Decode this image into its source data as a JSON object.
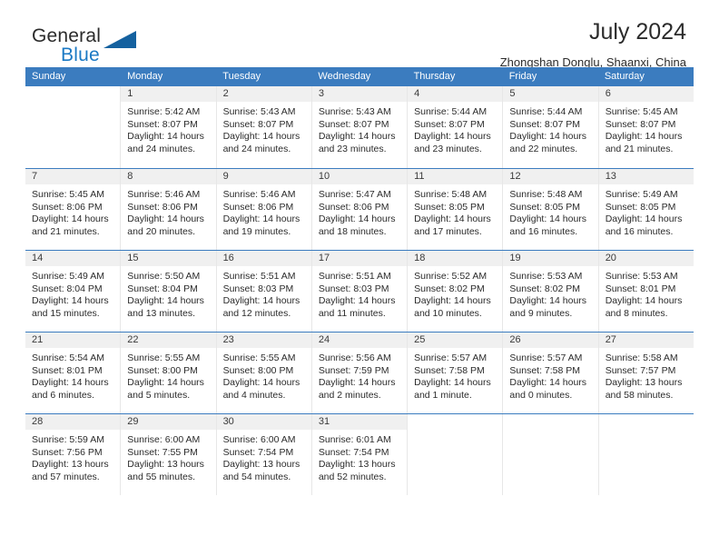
{
  "brand": {
    "word_general": "General",
    "word_blue": "Blue",
    "flag_icon": "blue-triangle-icon"
  },
  "header": {
    "title": "July 2024",
    "location": "Zhongshan Donglu, Shaanxi, China",
    "accent_color": "#3b7cbf"
  },
  "weekdays": [
    "Sunday",
    "Monday",
    "Tuesday",
    "Wednesday",
    "Thursday",
    "Friday",
    "Saturday"
  ],
  "weeks": [
    [
      {
        "day": "",
        "sunrise": "",
        "sunset": "",
        "daylight": ""
      },
      {
        "day": "1",
        "sunrise": "Sunrise: 5:42 AM",
        "sunset": "Sunset: 8:07 PM",
        "daylight": "Daylight: 14 hours and 24 minutes."
      },
      {
        "day": "2",
        "sunrise": "Sunrise: 5:43 AM",
        "sunset": "Sunset: 8:07 PM",
        "daylight": "Daylight: 14 hours and 24 minutes."
      },
      {
        "day": "3",
        "sunrise": "Sunrise: 5:43 AM",
        "sunset": "Sunset: 8:07 PM",
        "daylight": "Daylight: 14 hours and 23 minutes."
      },
      {
        "day": "4",
        "sunrise": "Sunrise: 5:44 AM",
        "sunset": "Sunset: 8:07 PM",
        "daylight": "Daylight: 14 hours and 23 minutes."
      },
      {
        "day": "5",
        "sunrise": "Sunrise: 5:44 AM",
        "sunset": "Sunset: 8:07 PM",
        "daylight": "Daylight: 14 hours and 22 minutes."
      },
      {
        "day": "6",
        "sunrise": "Sunrise: 5:45 AM",
        "sunset": "Sunset: 8:07 PM",
        "daylight": "Daylight: 14 hours and 21 minutes."
      }
    ],
    [
      {
        "day": "7",
        "sunrise": "Sunrise: 5:45 AM",
        "sunset": "Sunset: 8:06 PM",
        "daylight": "Daylight: 14 hours and 21 minutes."
      },
      {
        "day": "8",
        "sunrise": "Sunrise: 5:46 AM",
        "sunset": "Sunset: 8:06 PM",
        "daylight": "Daylight: 14 hours and 20 minutes."
      },
      {
        "day": "9",
        "sunrise": "Sunrise: 5:46 AM",
        "sunset": "Sunset: 8:06 PM",
        "daylight": "Daylight: 14 hours and 19 minutes."
      },
      {
        "day": "10",
        "sunrise": "Sunrise: 5:47 AM",
        "sunset": "Sunset: 8:06 PM",
        "daylight": "Daylight: 14 hours and 18 minutes."
      },
      {
        "day": "11",
        "sunrise": "Sunrise: 5:48 AM",
        "sunset": "Sunset: 8:05 PM",
        "daylight": "Daylight: 14 hours and 17 minutes."
      },
      {
        "day": "12",
        "sunrise": "Sunrise: 5:48 AM",
        "sunset": "Sunset: 8:05 PM",
        "daylight": "Daylight: 14 hours and 16 minutes."
      },
      {
        "day": "13",
        "sunrise": "Sunrise: 5:49 AM",
        "sunset": "Sunset: 8:05 PM",
        "daylight": "Daylight: 14 hours and 16 minutes."
      }
    ],
    [
      {
        "day": "14",
        "sunrise": "Sunrise: 5:49 AM",
        "sunset": "Sunset: 8:04 PM",
        "daylight": "Daylight: 14 hours and 15 minutes."
      },
      {
        "day": "15",
        "sunrise": "Sunrise: 5:50 AM",
        "sunset": "Sunset: 8:04 PM",
        "daylight": "Daylight: 14 hours and 13 minutes."
      },
      {
        "day": "16",
        "sunrise": "Sunrise: 5:51 AM",
        "sunset": "Sunset: 8:03 PM",
        "daylight": "Daylight: 14 hours and 12 minutes."
      },
      {
        "day": "17",
        "sunrise": "Sunrise: 5:51 AM",
        "sunset": "Sunset: 8:03 PM",
        "daylight": "Daylight: 14 hours and 11 minutes."
      },
      {
        "day": "18",
        "sunrise": "Sunrise: 5:52 AM",
        "sunset": "Sunset: 8:02 PM",
        "daylight": "Daylight: 14 hours and 10 minutes."
      },
      {
        "day": "19",
        "sunrise": "Sunrise: 5:53 AM",
        "sunset": "Sunset: 8:02 PM",
        "daylight": "Daylight: 14 hours and 9 minutes."
      },
      {
        "day": "20",
        "sunrise": "Sunrise: 5:53 AM",
        "sunset": "Sunset: 8:01 PM",
        "daylight": "Daylight: 14 hours and 8 minutes."
      }
    ],
    [
      {
        "day": "21",
        "sunrise": "Sunrise: 5:54 AM",
        "sunset": "Sunset: 8:01 PM",
        "daylight": "Daylight: 14 hours and 6 minutes."
      },
      {
        "day": "22",
        "sunrise": "Sunrise: 5:55 AM",
        "sunset": "Sunset: 8:00 PM",
        "daylight": "Daylight: 14 hours and 5 minutes."
      },
      {
        "day": "23",
        "sunrise": "Sunrise: 5:55 AM",
        "sunset": "Sunset: 8:00 PM",
        "daylight": "Daylight: 14 hours and 4 minutes."
      },
      {
        "day": "24",
        "sunrise": "Sunrise: 5:56 AM",
        "sunset": "Sunset: 7:59 PM",
        "daylight": "Daylight: 14 hours and 2 minutes."
      },
      {
        "day": "25",
        "sunrise": "Sunrise: 5:57 AM",
        "sunset": "Sunset: 7:58 PM",
        "daylight": "Daylight: 14 hours and 1 minute."
      },
      {
        "day": "26",
        "sunrise": "Sunrise: 5:57 AM",
        "sunset": "Sunset: 7:58 PM",
        "daylight": "Daylight: 14 hours and 0 minutes."
      },
      {
        "day": "27",
        "sunrise": "Sunrise: 5:58 AM",
        "sunset": "Sunset: 7:57 PM",
        "daylight": "Daylight: 13 hours and 58 minutes."
      }
    ],
    [
      {
        "day": "28",
        "sunrise": "Sunrise: 5:59 AM",
        "sunset": "Sunset: 7:56 PM",
        "daylight": "Daylight: 13 hours and 57 minutes."
      },
      {
        "day": "29",
        "sunrise": "Sunrise: 6:00 AM",
        "sunset": "Sunset: 7:55 PM",
        "daylight": "Daylight: 13 hours and 55 minutes."
      },
      {
        "day": "30",
        "sunrise": "Sunrise: 6:00 AM",
        "sunset": "Sunset: 7:54 PM",
        "daylight": "Daylight: 13 hours and 54 minutes."
      },
      {
        "day": "31",
        "sunrise": "Sunrise: 6:01 AM",
        "sunset": "Sunset: 7:54 PM",
        "daylight": "Daylight: 13 hours and 52 minutes."
      },
      {
        "day": "",
        "sunrise": "",
        "sunset": "",
        "daylight": ""
      },
      {
        "day": "",
        "sunrise": "",
        "sunset": "",
        "daylight": ""
      },
      {
        "day": "",
        "sunrise": "",
        "sunset": "",
        "daylight": ""
      }
    ]
  ]
}
